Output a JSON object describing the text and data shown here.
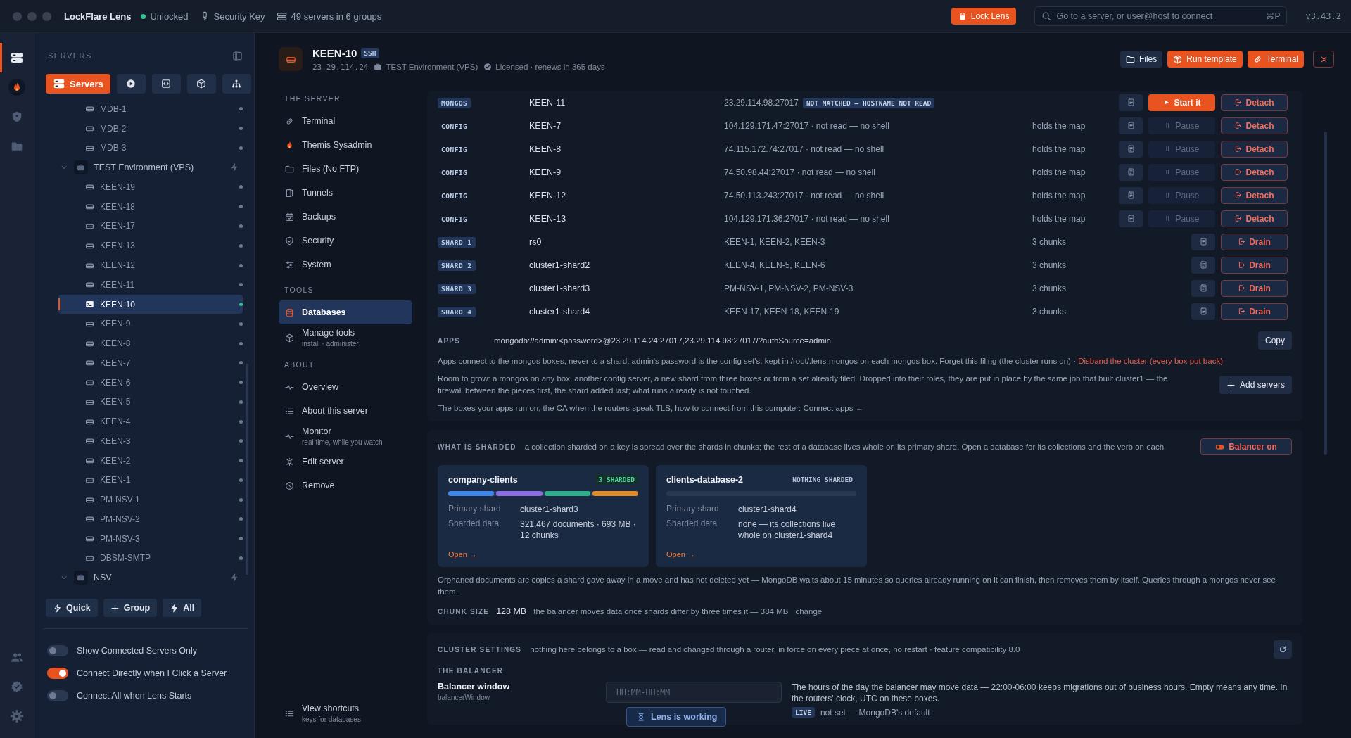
{
  "titlebar": {
    "app_name": "LockFlare Lens",
    "lock_status": "Unlocked",
    "unlocked": true,
    "security_key": "Security Key",
    "server_count": "49 servers in 6 groups",
    "lock_button": "Lock Lens",
    "search": {
      "placeholder": "Go to a server, or user@host to connect",
      "shortcut": "⌘P"
    },
    "version": "v3.43.2"
  },
  "rail": {
    "items": [
      {
        "kind": "servers",
        "selected": true
      },
      {
        "kind": "sysadmin",
        "selected": false
      },
      {
        "kind": "security",
        "selected": false
      },
      {
        "kind": "files",
        "selected": false
      }
    ],
    "bottom": [
      {
        "kind": "people"
      },
      {
        "kind": "verified"
      },
      {
        "kind": "settings"
      }
    ]
  },
  "sidebar": {
    "title": "SERVERS",
    "view_tabs": [
      {
        "kind": "servers",
        "label": "Servers",
        "selected": true
      },
      {
        "kind": "play",
        "selected": false
      },
      {
        "kind": "code",
        "selected": false
      },
      {
        "kind": "package",
        "selected": false
      },
      {
        "kind": "hierarchy",
        "selected": false
      }
    ],
    "tree": [
      {
        "kind": "server",
        "name": "MDB-1",
        "selected": false,
        "connected": false
      },
      {
        "kind": "server",
        "name": "MDB-2",
        "selected": false,
        "connected": false
      },
      {
        "kind": "server",
        "name": "MDB-3",
        "selected": false,
        "connected": false
      },
      {
        "kind": "group",
        "name": "TEST Environment (VPS)",
        "expanded": true,
        "children": [
          {
            "kind": "server",
            "name": "KEEN-19",
            "selected": false,
            "connected": false
          },
          {
            "kind": "server",
            "name": "KEEN-18",
            "selected": false,
            "connected": false
          },
          {
            "kind": "server",
            "name": "KEEN-17",
            "selected": false,
            "connected": false
          },
          {
            "kind": "server",
            "name": "KEEN-13",
            "selected": false,
            "connected": false
          },
          {
            "kind": "server",
            "name": "KEEN-12",
            "selected": false,
            "connected": false
          },
          {
            "kind": "server",
            "name": "KEEN-11",
            "selected": false,
            "connected": false
          },
          {
            "kind": "server",
            "name": "KEEN-10",
            "selected": true,
            "connected": true
          },
          {
            "kind": "server",
            "name": "KEEN-9",
            "selected": false,
            "connected": false
          },
          {
            "kind": "server",
            "name": "KEEN-8",
            "selected": false,
            "connected": false
          },
          {
            "kind": "server",
            "name": "KEEN-7",
            "selected": false,
            "connected": false
          },
          {
            "kind": "server",
            "name": "KEEN-6",
            "selected": false,
            "connected": false
          },
          {
            "kind": "server",
            "name": "KEEN-5",
            "selected": false,
            "connected": false
          },
          {
            "kind": "server",
            "name": "KEEN-4",
            "selected": false,
            "connected": false
          },
          {
            "kind": "server",
            "name": "KEEN-3",
            "selected": false,
            "connected": false
          },
          {
            "kind": "server",
            "name": "KEEN-2",
            "selected": false,
            "connected": false
          },
          {
            "kind": "server",
            "name": "KEEN-1",
            "selected": false,
            "connected": false
          },
          {
            "kind": "server",
            "name": "PM-NSV-1",
            "selected": false,
            "connected": false
          },
          {
            "kind": "server",
            "name": "PM-NSV-2",
            "selected": false,
            "connected": false
          },
          {
            "kind": "server",
            "name": "PM-NSV-3",
            "selected": false,
            "connected": false
          },
          {
            "kind": "server",
            "name": "DBSM-SMTP",
            "selected": false,
            "connected": false
          }
        ]
      },
      {
        "kind": "group",
        "name": "NSV",
        "expanded": true
      }
    ],
    "buttons": [
      {
        "kind": "quick",
        "label": "Quick"
      },
      {
        "kind": "group",
        "label": "Group"
      },
      {
        "kind": "all",
        "label": "All"
      }
    ],
    "toggles": [
      {
        "label": "Show Connected Servers Only",
        "on": false
      },
      {
        "label": "Connect Directly when I Click a Server",
        "on": true
      },
      {
        "label": "Connect All when Lens Starts",
        "on": false
      }
    ]
  },
  "header": {
    "title": "KEEN-10",
    "protocol": "SSH",
    "address": "23.29.114.24",
    "group": "TEST Environment (VPS)",
    "license": "Licensed · renews in 365 days",
    "actions": [
      {
        "kind": "files",
        "label": "Files"
      },
      {
        "kind": "template",
        "label": "Run template"
      },
      {
        "kind": "terminal",
        "label": "Terminal"
      },
      {
        "kind": "close"
      }
    ]
  },
  "nav": {
    "sections": [
      {
        "title": "THE SERVER",
        "items": [
          {
            "kind": "terminal",
            "label": "Terminal",
            "selected": false
          },
          {
            "kind": "sysadmin",
            "label": "Themis Sysadmin",
            "selected": false
          },
          {
            "kind": "files",
            "label": "Files (No FTP)",
            "selected": false
          },
          {
            "kind": "tunnels",
            "label": "Tunnels",
            "selected": false
          },
          {
            "kind": "backups",
            "label": "Backups",
            "selected": false
          },
          {
            "kind": "security",
            "label": "Security",
            "selected": false
          },
          {
            "kind": "system",
            "label": "System",
            "selected": false
          }
        ]
      },
      {
        "title": "TOOLS",
        "items": [
          {
            "kind": "databases",
            "label": "Databases",
            "selected": true
          },
          {
            "kind": "tools",
            "label": "Manage tools",
            "sub": "install · administer",
            "selected": false
          }
        ]
      },
      {
        "title": "ABOUT",
        "items": [
          {
            "kind": "overview",
            "label": "Overview",
            "selected": false
          },
          {
            "kind": "about",
            "label": "About this server",
            "selected": false
          },
          {
            "kind": "monitor",
            "label": "Monitor",
            "sub": "real time, while you watch",
            "selected": false
          },
          {
            "kind": "edit",
            "label": "Edit server",
            "selected": false
          },
          {
            "kind": "remove",
            "label": "Remove",
            "selected": false
          }
        ]
      }
    ],
    "footer": {
      "kind": "shortcuts",
      "label": "View shortcuts",
      "sub": "keys for databases"
    }
  },
  "cluster": {
    "rows": [
      {
        "role": "MONGOS",
        "kind": "mongos",
        "name": "KEEN-11",
        "address": "23.29.114.98:27017",
        "warning": "NOT MATCHED — HOSTNAME NOT READ",
        "actions": [
          {
            "kind": "log"
          },
          {
            "kind": "start",
            "label": "Start it"
          },
          {
            "kind": "detach",
            "label": "Detach"
          }
        ]
      },
      {
        "role": "CONFIG",
        "kind": "config",
        "name": "KEEN-7",
        "address": "104.129.171.47:27017 · not read — no shell",
        "note": "holds the map",
        "actions": [
          {
            "kind": "log"
          },
          {
            "kind": "pause",
            "label": "Pause"
          },
          {
            "kind": "detach",
            "label": "Detach"
          }
        ]
      },
      {
        "role": "CONFIG",
        "kind": "config",
        "name": "KEEN-8",
        "address": "74.115.172.74:27017 · not read — no shell",
        "note": "holds the map",
        "actions": [
          {
            "kind": "log"
          },
          {
            "kind": "pause",
            "label": "Pause"
          },
          {
            "kind": "detach",
            "label": "Detach"
          }
        ]
      },
      {
        "role": "CONFIG",
        "kind": "config",
        "name": "KEEN-9",
        "address": "74.50.98.44:27017 · not read — no shell",
        "note": "holds the map",
        "actions": [
          {
            "kind": "log"
          },
          {
            "kind": "pause",
            "label": "Pause"
          },
          {
            "kind": "detach",
            "label": "Detach"
          }
        ]
      },
      {
        "role": "CONFIG",
        "kind": "config",
        "name": "KEEN-12",
        "address": "74.50.113.243:27017 · not read — no shell",
        "note": "holds the map",
        "actions": [
          {
            "kind": "log"
          },
          {
            "kind": "pause",
            "label": "Pause"
          },
          {
            "kind": "detach",
            "label": "Detach"
          }
        ]
      },
      {
        "role": "CONFIG",
        "kind": "config",
        "name": "KEEN-13",
        "address": "104.129.171.36:27017 · not read — no shell",
        "note": "holds the map",
        "actions": [
          {
            "kind": "log"
          },
          {
            "kind": "pause",
            "label": "Pause"
          },
          {
            "kind": "detach",
            "label": "Detach"
          }
        ]
      },
      {
        "role": "SHARD 1",
        "kind": "shard",
        "name": "rs0",
        "address": "KEEN-1, KEEN-2, KEEN-3",
        "note": "3 chunks",
        "actions": [
          {
            "kind": "log"
          },
          {
            "kind": "drain",
            "label": "Drain"
          }
        ]
      },
      {
        "role": "SHARD 2",
        "kind": "shard",
        "name": "cluster1-shard2",
        "address": "KEEN-4, KEEN-5, KEEN-6",
        "note": "3 chunks",
        "actions": [
          {
            "kind": "log"
          },
          {
            "kind": "drain",
            "label": "Drain"
          }
        ]
      },
      {
        "role": "SHARD 3",
        "kind": "shard",
        "name": "cluster1-shard3",
        "address": "PM-NSV-1, PM-NSV-2, PM-NSV-3",
        "note": "3 chunks",
        "actions": [
          {
            "kind": "log"
          },
          {
            "kind": "drain",
            "label": "Drain"
          }
        ]
      },
      {
        "role": "SHARD 4",
        "kind": "shard",
        "name": "cluster1-shard4",
        "address": "KEEN-17, KEEN-18, KEEN-19",
        "note": "3 chunks",
        "actions": [
          {
            "kind": "log"
          },
          {
            "kind": "drain",
            "label": "Drain"
          }
        ]
      }
    ],
    "apps": {
      "label": "APPS",
      "uri": "mongodb://admin:<password>@23.29.114.24:27017,23.29.114.98:27017/?authSource=admin",
      "copy_button": "Copy",
      "note": "Apps connect to the mongos boxes, never to a shard. admin's password is the config set's, kept in /root/.lens-mongos on each mongos box. Forget this filing (the cluster runs on) · ",
      "danger_link": "Disband the cluster (every box put back)",
      "grow": "Room to grow: a mongos on any box, another config server, a new shard from three boxes or from a set already filed. Dropped into their roles, they are put in place by the same job that built cluster1 — the firewall between the pieces first, the shard added last; what runs already is not touched.",
      "add_button": "Add servers",
      "connect": "The boxes your apps run on, the CA when the routers speak TLS, how to connect from this computer: ",
      "connect_link": "Connect apps →"
    }
  },
  "sharding": {
    "label": "WHAT IS SHARDED",
    "description": "a collection sharded on a key is spread over the shards in chunks; the rest of a database lives whole on its primary shard. Open a database for its collections and the verb on each.",
    "balancer_button": "Balancer on",
    "balancer_on": true,
    "databases": [
      {
        "name": "company-clients",
        "badge": "3 SHARDED",
        "kind": "sharded",
        "segments": [
          {
            "color": "#3f86e8"
          },
          {
            "color": "#8b6fe0"
          },
          {
            "color": "#2fae8c"
          },
          {
            "color": "#e08a2a"
          }
        ],
        "primary_label": "Primary shard",
        "primary": "cluster1-shard3",
        "data_label": "Sharded data",
        "data": "321,467 documents · 693 MB · 12 chunks",
        "open": "Open →"
      },
      {
        "name": "clients-database-2",
        "badge": "NOTHING SHARDED",
        "kind": "none",
        "primary_label": "Primary shard",
        "primary": "cluster1-shard4",
        "data_label": "Sharded data",
        "data": "none — its collections live whole on cluster1-shard4",
        "open": "Open →"
      }
    ],
    "orphans": "Orphaned documents are copies a shard gave away in a move and has not deleted yet — MongoDB waits about 15 minutes so queries already running on it can finish, then removes them by itself. Queries through a mongos never see them.",
    "chunk": {
      "label": "CHUNK SIZE",
      "value": "128 MB",
      "note": "the balancer moves data once shards differ by three times it — 384 MB",
      "link": "change"
    }
  },
  "settings": {
    "label": "CLUSTER SETTINGS",
    "description": "nothing here belongs to a box — read and changed through a router, in force on every piece at once, no restart · feature compatibility 8.0",
    "subheading": "THE BALANCER",
    "fields": [
      {
        "label": "Balancer window",
        "key": "balancerWindow",
        "placeholder": "HH:MM-HH:MM",
        "help": "The hours of the day the balancer may move data — 22:00-06:00 keeps migrations out of business hours. Empty means any time. In the routers' clock, UTC on these boxes.",
        "badge": "LIVE",
        "status": "not set — MongoDB's default"
      }
    ]
  },
  "toast": {
    "label": "Lens is working"
  }
}
